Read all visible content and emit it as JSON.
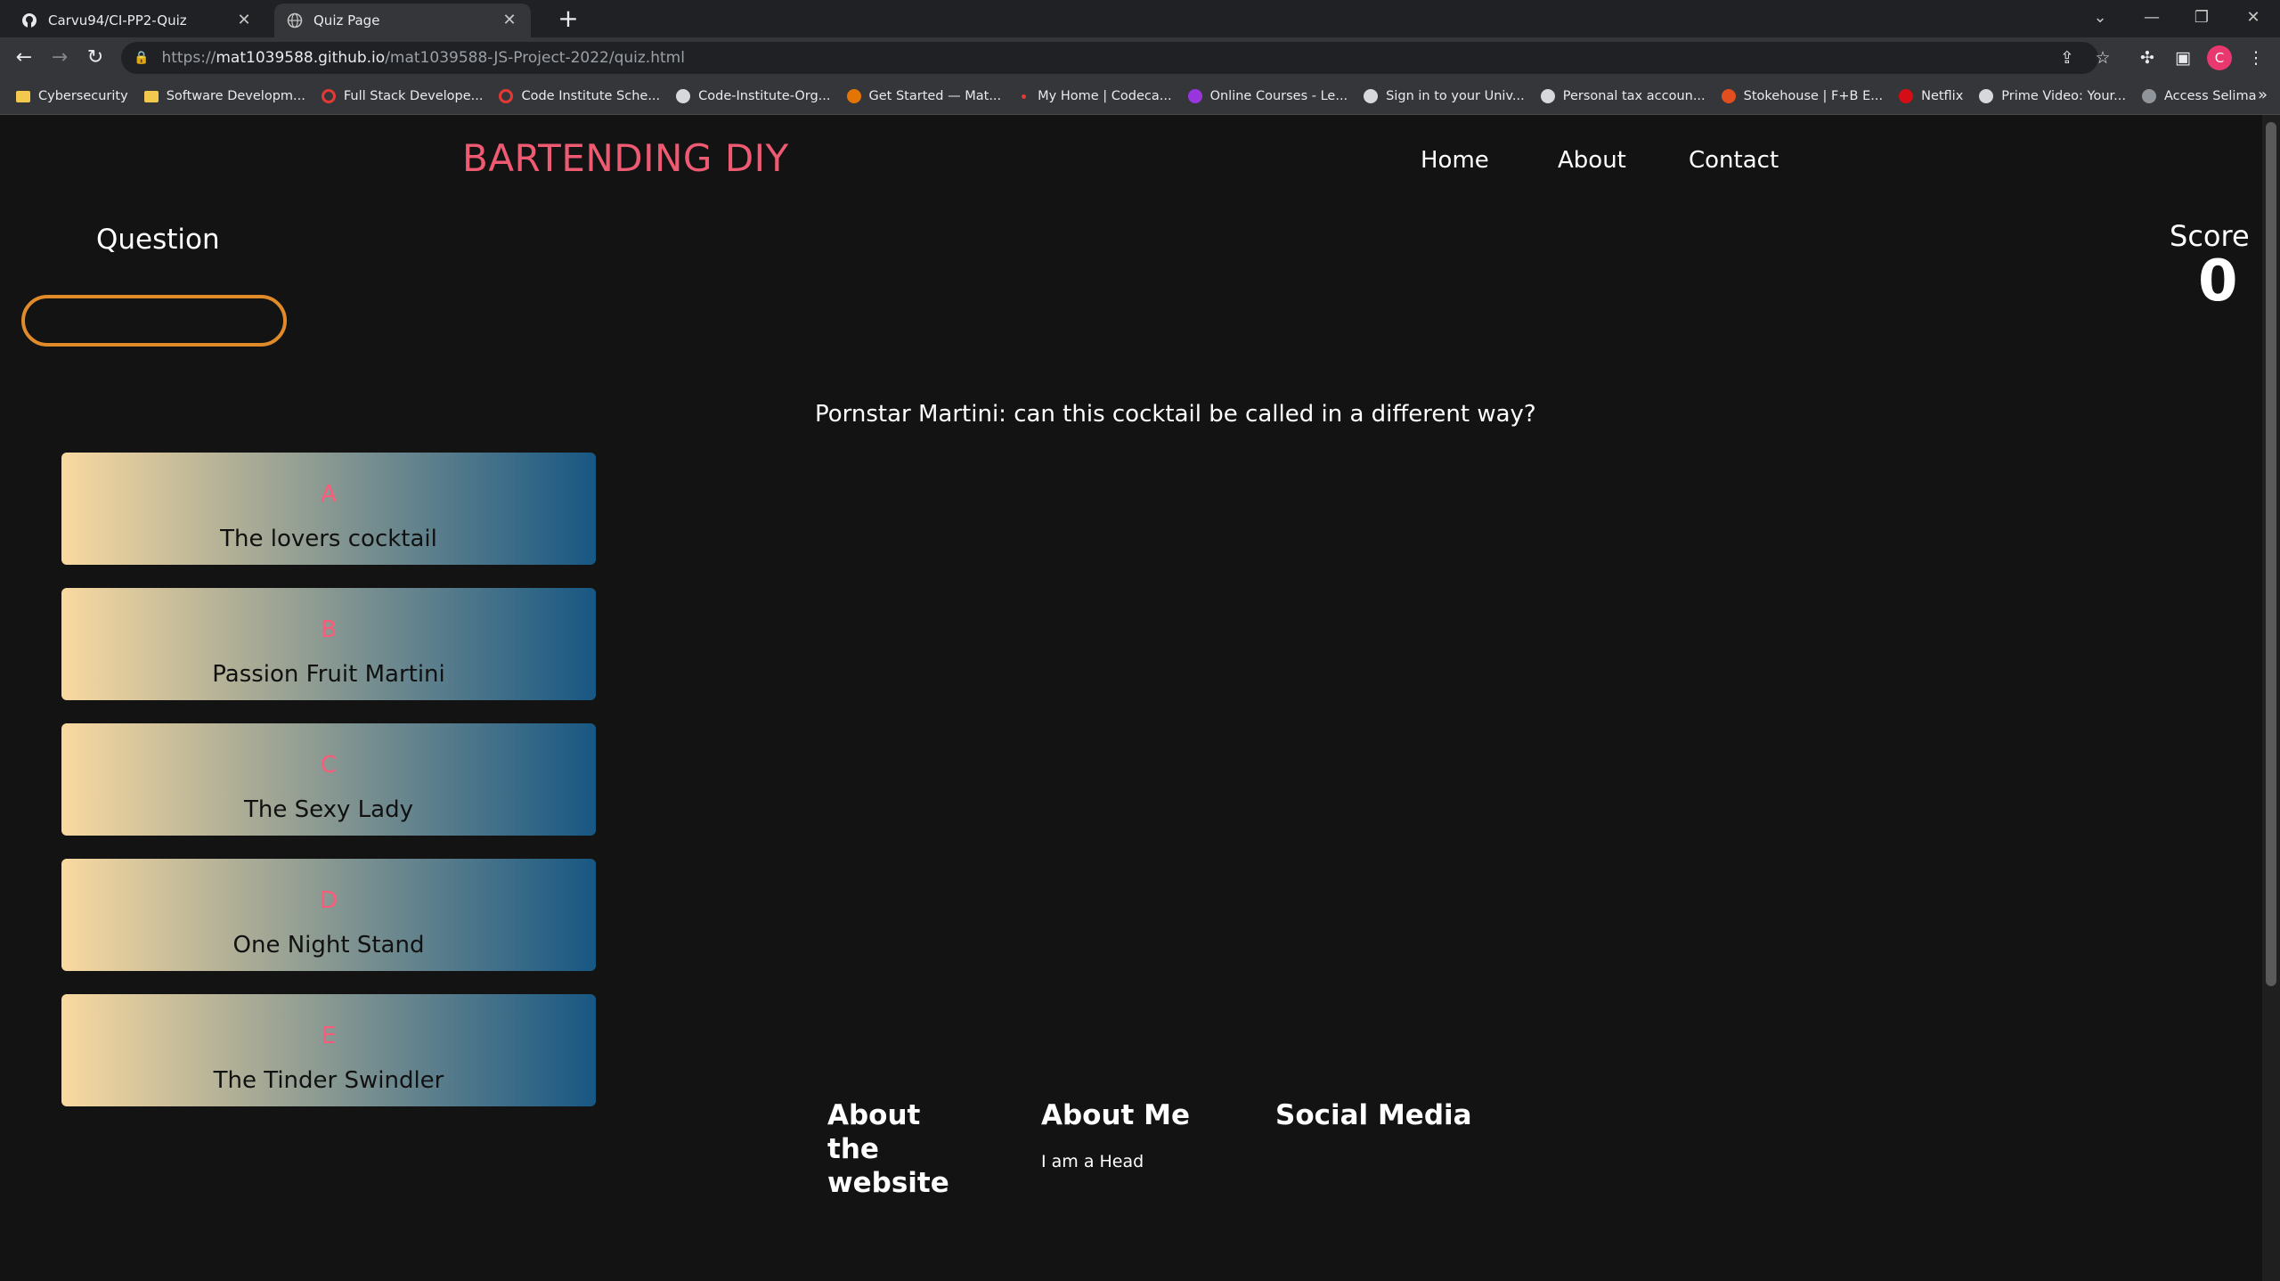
{
  "browser": {
    "tabs": [
      {
        "title": "Carvu94/CI-PP2-Quiz",
        "icon": "github-icon",
        "active": false
      },
      {
        "title": "Quiz Page",
        "icon": "globe-icon",
        "active": true
      }
    ],
    "url": {
      "scheme": "https://",
      "host": "mat1039588.github.io",
      "path": "/mat1039588-JS-Project-2022/quiz.html"
    },
    "profile_initial": "C",
    "bookmarks": [
      {
        "label": "Cybersecurity",
        "icon": "folder-icon",
        "color": "#f2c94c"
      },
      {
        "label": "Software Developm...",
        "icon": "folder-icon",
        "color": "#f2c94c"
      },
      {
        "label": "Full Stack Develope...",
        "icon": "circle-icon",
        "color": "#e53935"
      },
      {
        "label": "Code Institute Sche...",
        "icon": "circle-icon",
        "color": "#e53935"
      },
      {
        "label": "Code-Institute-Org...",
        "icon": "github-icon",
        "color": "#e8eaed"
      },
      {
        "label": "Get Started — Mat...",
        "icon": "g-icon",
        "color": "#f57c00"
      },
      {
        "label": "My Home | Codeca...",
        "icon": "dot-icon",
        "color": "#e53935"
      },
      {
        "label": "Online Courses - Le...",
        "icon": "udemy-icon",
        "color": "#a435f0"
      },
      {
        "label": "Sign in to your Univ...",
        "icon": "crown-icon",
        "color": "#e8eaed"
      },
      {
        "label": "Personal tax accoun...",
        "icon": "crown-icon",
        "color": "#e8eaed"
      },
      {
        "label": "Stokehouse | F+B E...",
        "icon": "plus-icon",
        "color": "#f4511e"
      },
      {
        "label": "Netflix",
        "icon": "netflix-icon",
        "color": "#e50914"
      },
      {
        "label": "Prime Video: Your...",
        "icon": "amazon-icon",
        "color": "#e8eaed"
      },
      {
        "label": "Access Selima",
        "icon": "globe-icon",
        "color": "#9aa0a6"
      }
    ]
  },
  "header": {
    "brand": "BARTENDING DIY",
    "nav": [
      "Home",
      "About",
      "Contact"
    ]
  },
  "quiz": {
    "question_label": "Question",
    "progress_fraction": 0,
    "score_label": "Score",
    "score": "0",
    "question": "Pornstar Martini: can this cocktail be called in a different way?",
    "answers": [
      {
        "letter": "A",
        "text": "The lovers cocktail"
      },
      {
        "letter": "B",
        "text": "Passion Fruit Martini"
      },
      {
        "letter": "C",
        "text": "The Sexy Lady"
      },
      {
        "letter": "D",
        "text": "One Night Stand"
      },
      {
        "letter": "E",
        "text": "The Tinder Swindler"
      }
    ],
    "colors": {
      "brand": "#ef5a73",
      "letter": "#ff5a79",
      "progress": "#e08a2a",
      "gradient_start": "#f9d9a0",
      "gradient_end": "#175783"
    }
  },
  "footer": {
    "about_website": "About the website",
    "about_me": "About Me",
    "about_me_text": "I am a Head",
    "social": "Social Media"
  }
}
